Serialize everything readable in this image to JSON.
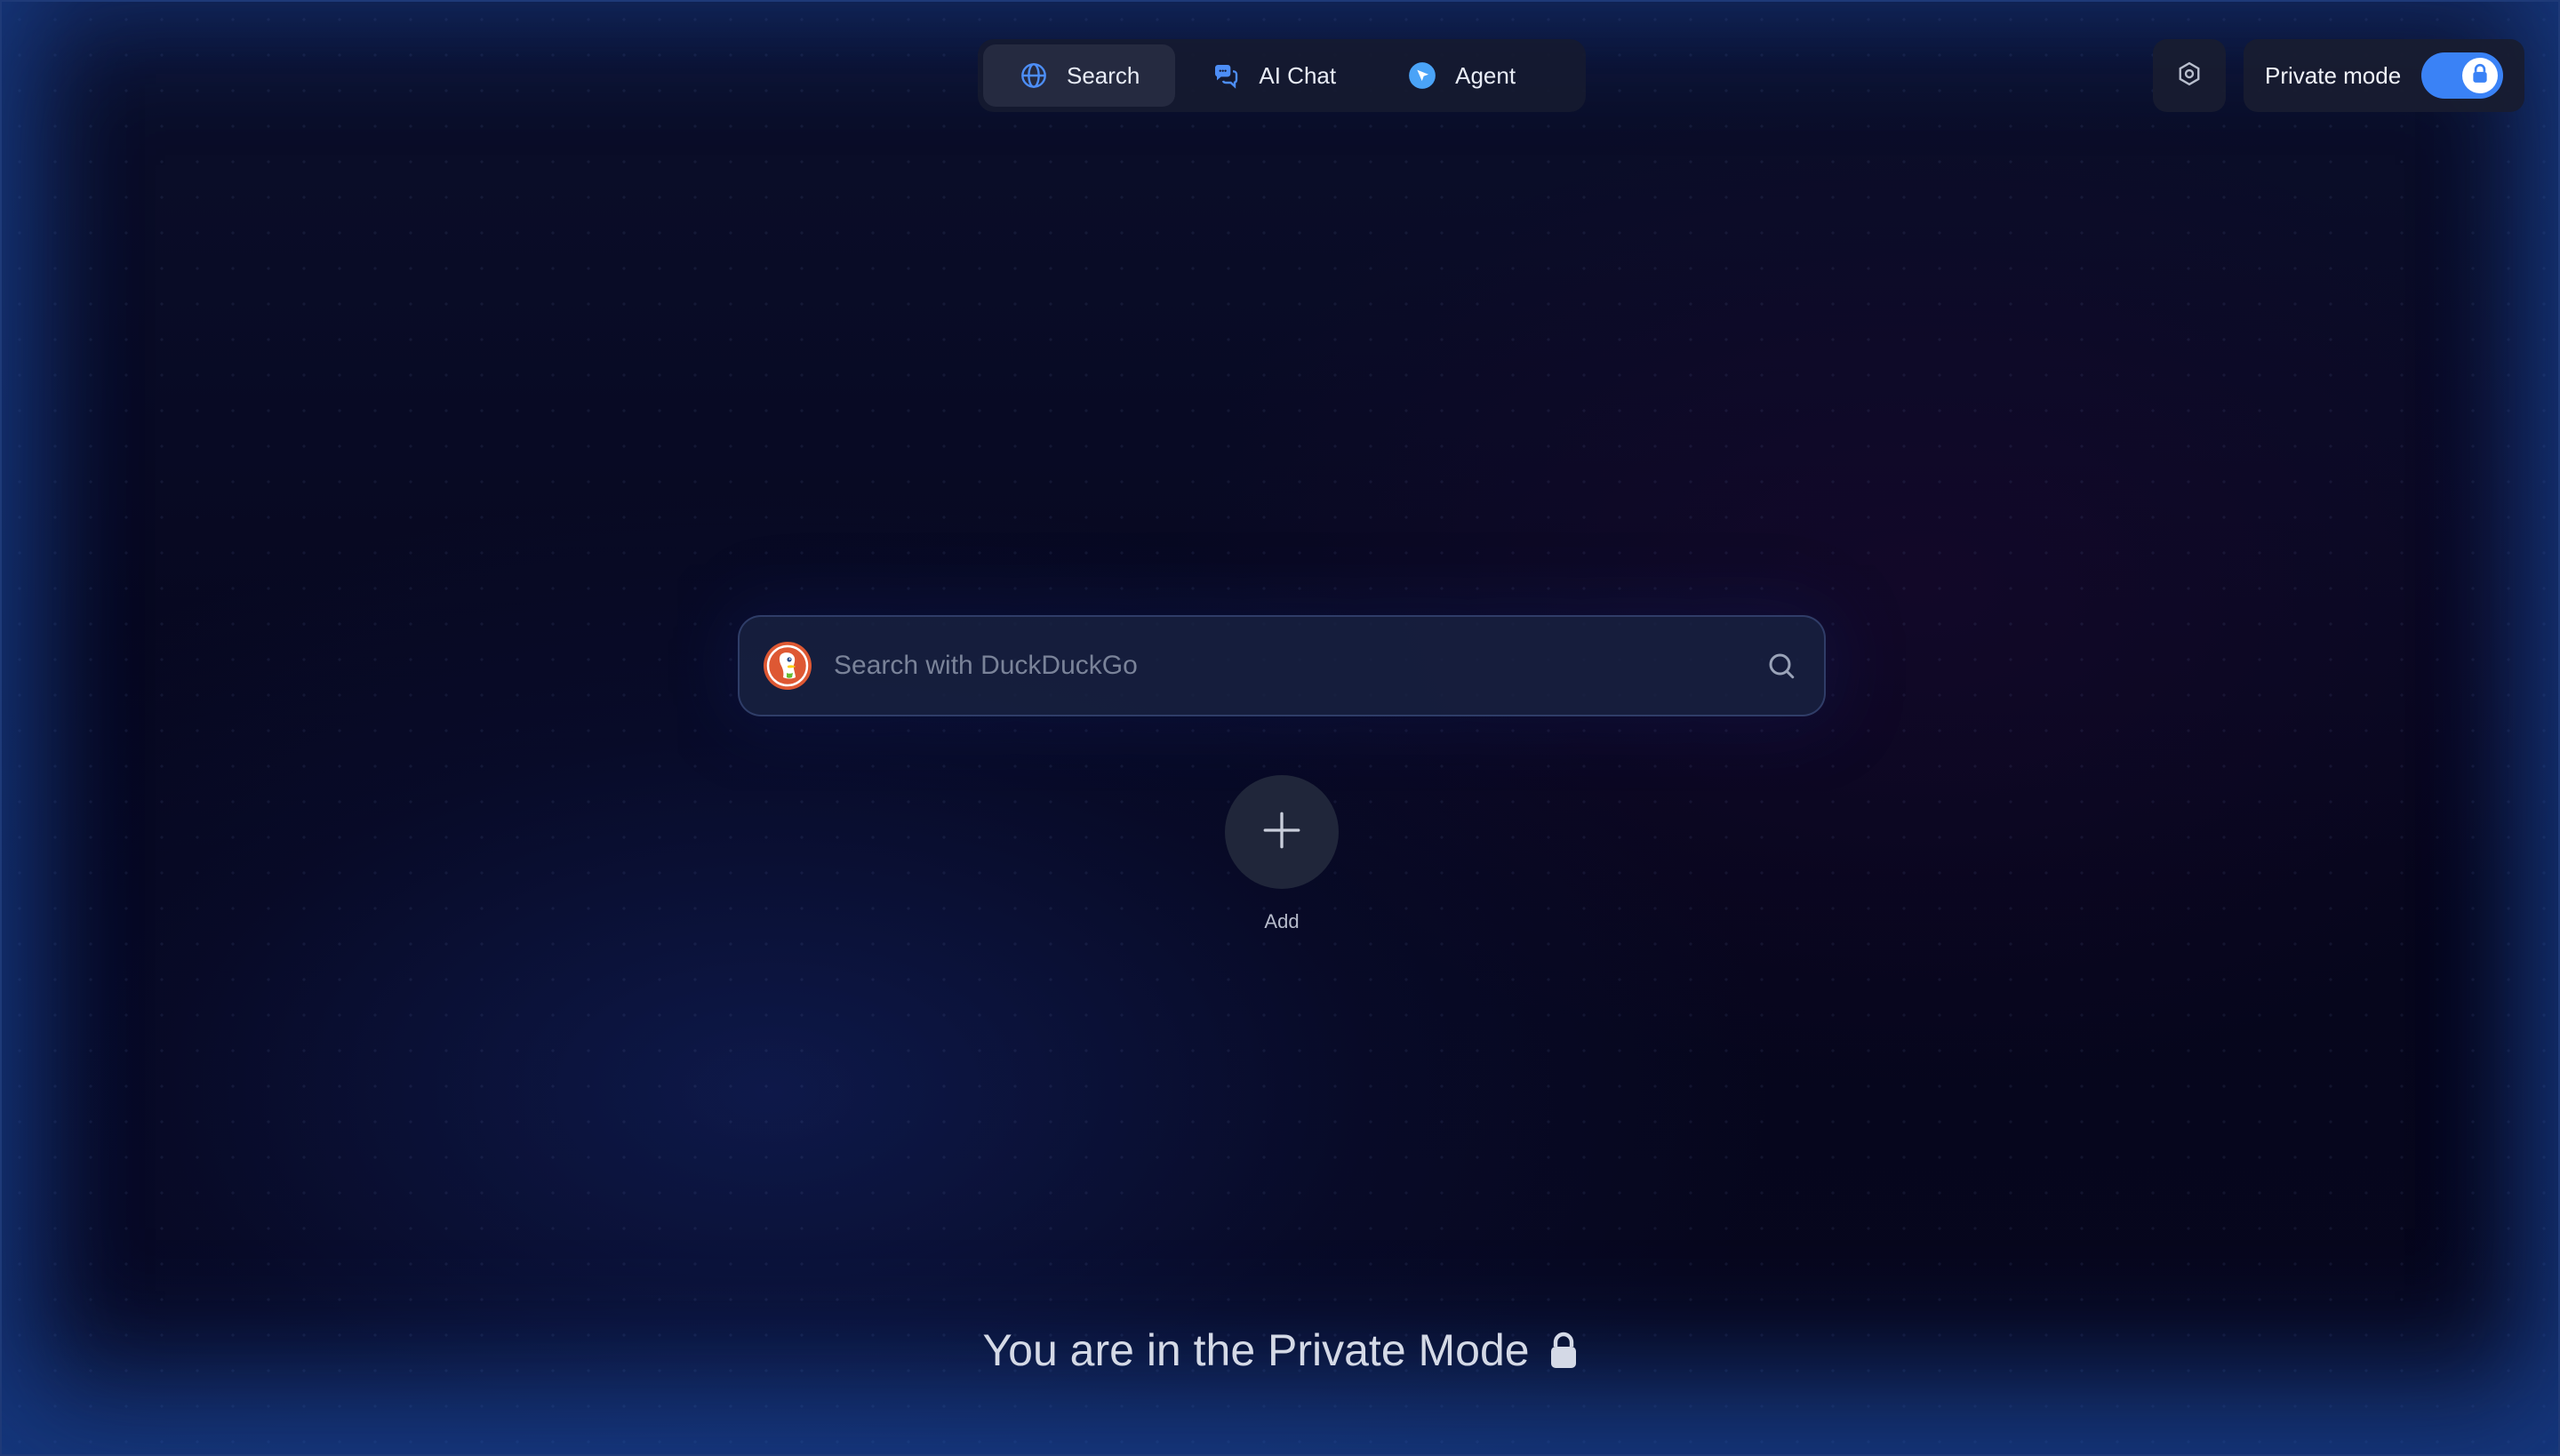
{
  "modes": {
    "tabs": [
      {
        "label": "Search",
        "icon": "globe-icon",
        "active": true
      },
      {
        "label": "AI Chat",
        "icon": "chat-bubbles-icon",
        "active": false
      },
      {
        "label": "Agent",
        "icon": "agent-cursor-icon",
        "active": false
      }
    ]
  },
  "header": {
    "settings_icon": "settings-hexagon-icon",
    "private_mode_label": "Private mode",
    "private_mode_enabled": true
  },
  "search": {
    "engine_icon": "duckduckgo-logo",
    "placeholder": "Search with DuckDuckGo",
    "value": "",
    "submit_icon": "search-icon"
  },
  "shortcuts": {
    "add_label": "Add",
    "add_icon": "plus-icon"
  },
  "footer": {
    "message": "You are in the Private Mode",
    "message_icon": "lock-icon"
  },
  "colors": {
    "accent": "#3a82f6",
    "background": "#07071c"
  }
}
